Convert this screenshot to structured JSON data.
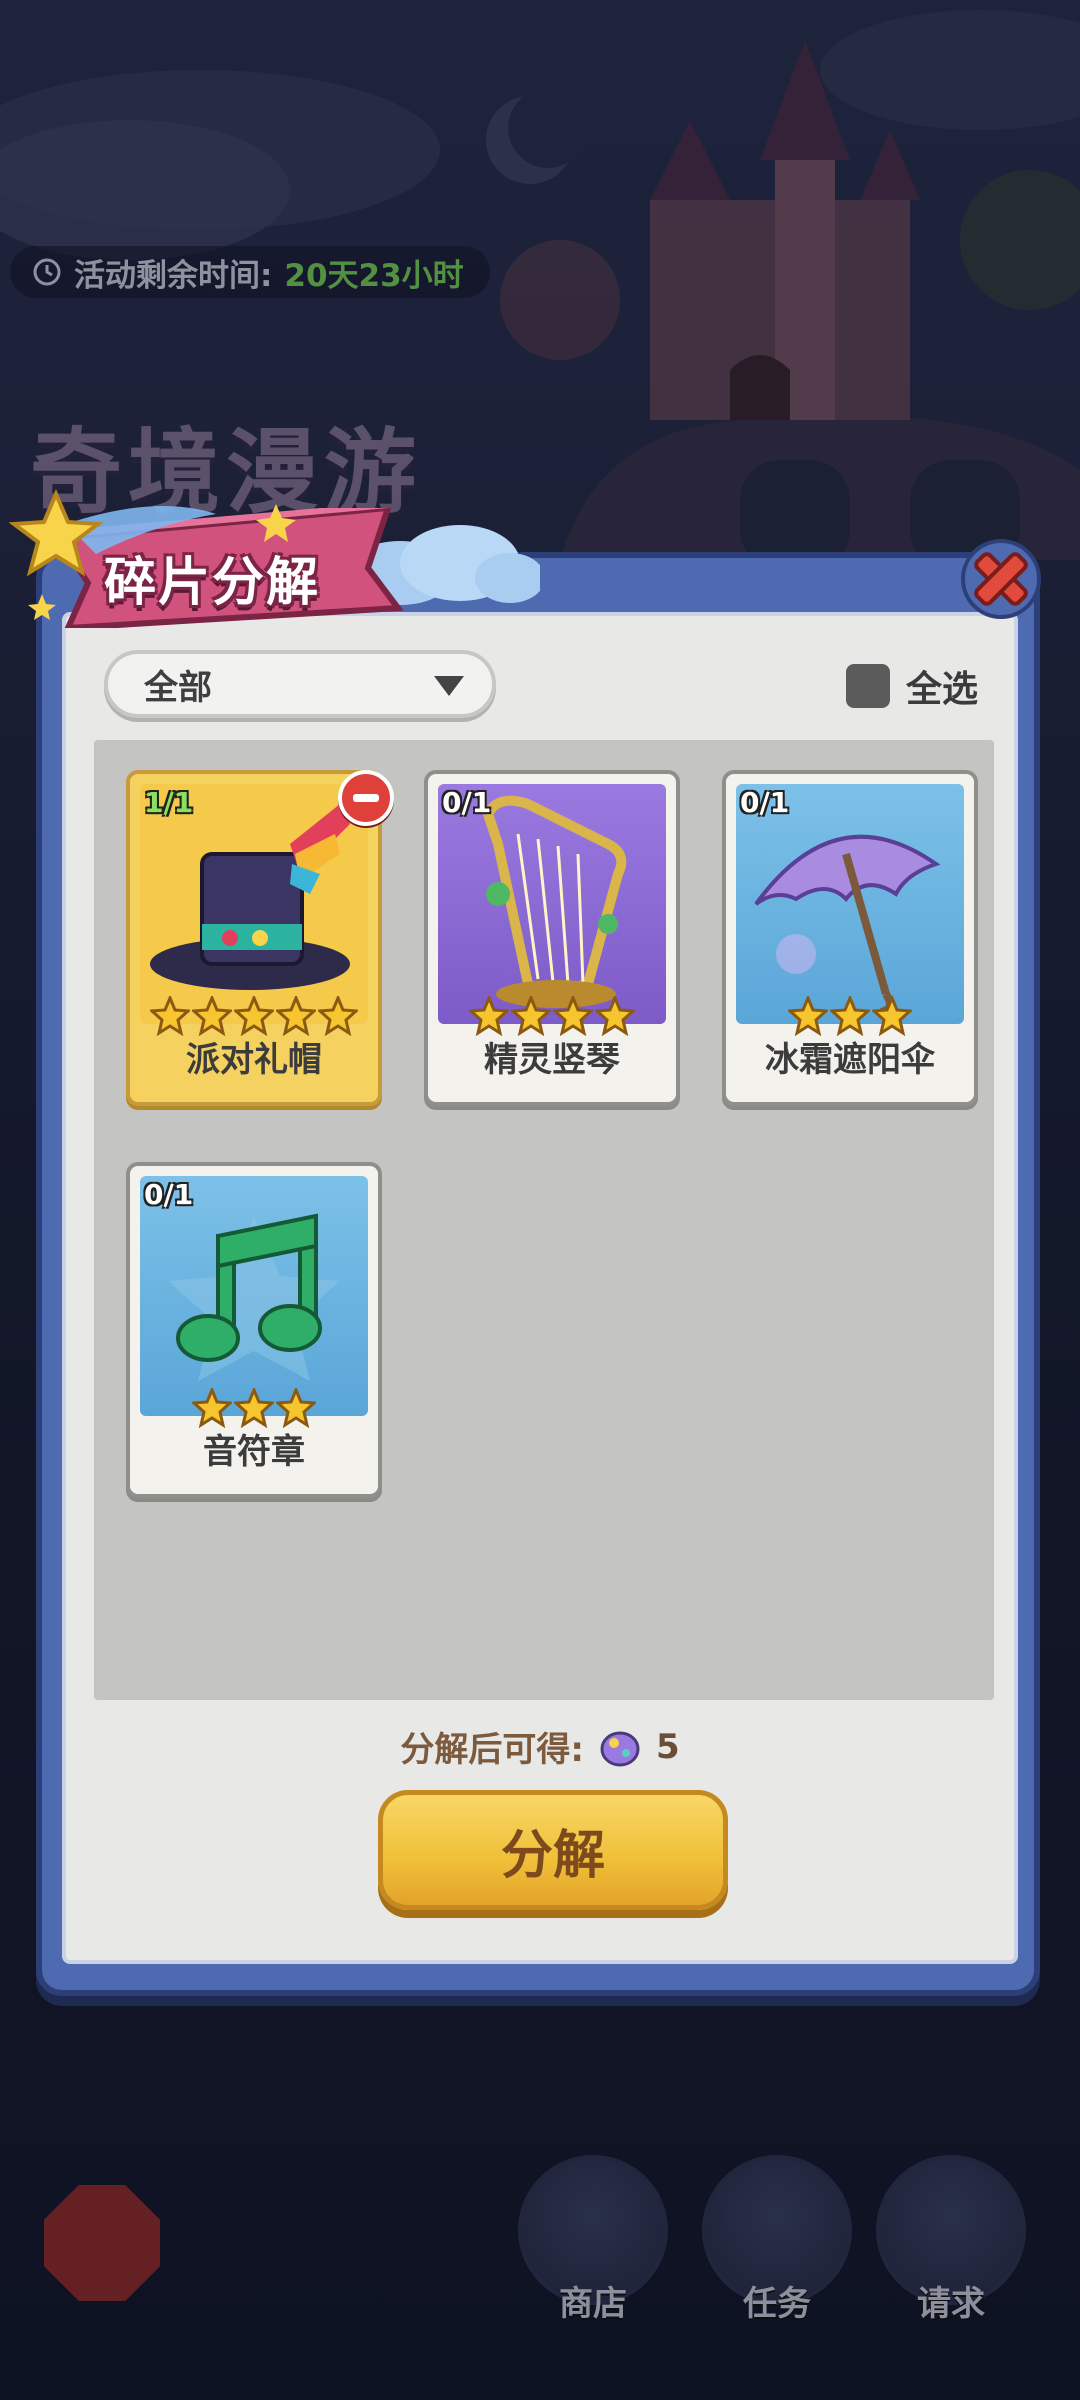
{
  "event": {
    "timer_label": "活动剩余时间:",
    "timer_value": "20天23小时",
    "title": "奇境漫游"
  },
  "modal": {
    "title": "碎片分解",
    "filter_selected": "全部",
    "select_all_label": "全选",
    "reward_label": "分解后可得:",
    "reward_value": "5",
    "decompose_label": "分解"
  },
  "items": [
    {
      "name": "派对礼帽",
      "count": "1/1",
      "stars": 5,
      "selected": true,
      "bg": "#f5c94a"
    },
    {
      "name": "精灵竖琴",
      "count": "0/1",
      "stars": 4,
      "selected": false,
      "bg": "#8f6fd6"
    },
    {
      "name": "冰霜遮阳伞",
      "count": "0/1",
      "stars": 3,
      "selected": false,
      "bg": "#6fb8e0"
    },
    {
      "name": "音符章",
      "count": "0/1",
      "stars": 3,
      "selected": false,
      "bg": "#6fb8e0"
    }
  ],
  "bottom_nav": {
    "shop": "商店",
    "tasks": "任务",
    "request": "请求"
  },
  "colors": {
    "accent_gold": "#f0bf38",
    "frame_blue": "#4e6ab0",
    "banner_pink": "#d0527d"
  }
}
